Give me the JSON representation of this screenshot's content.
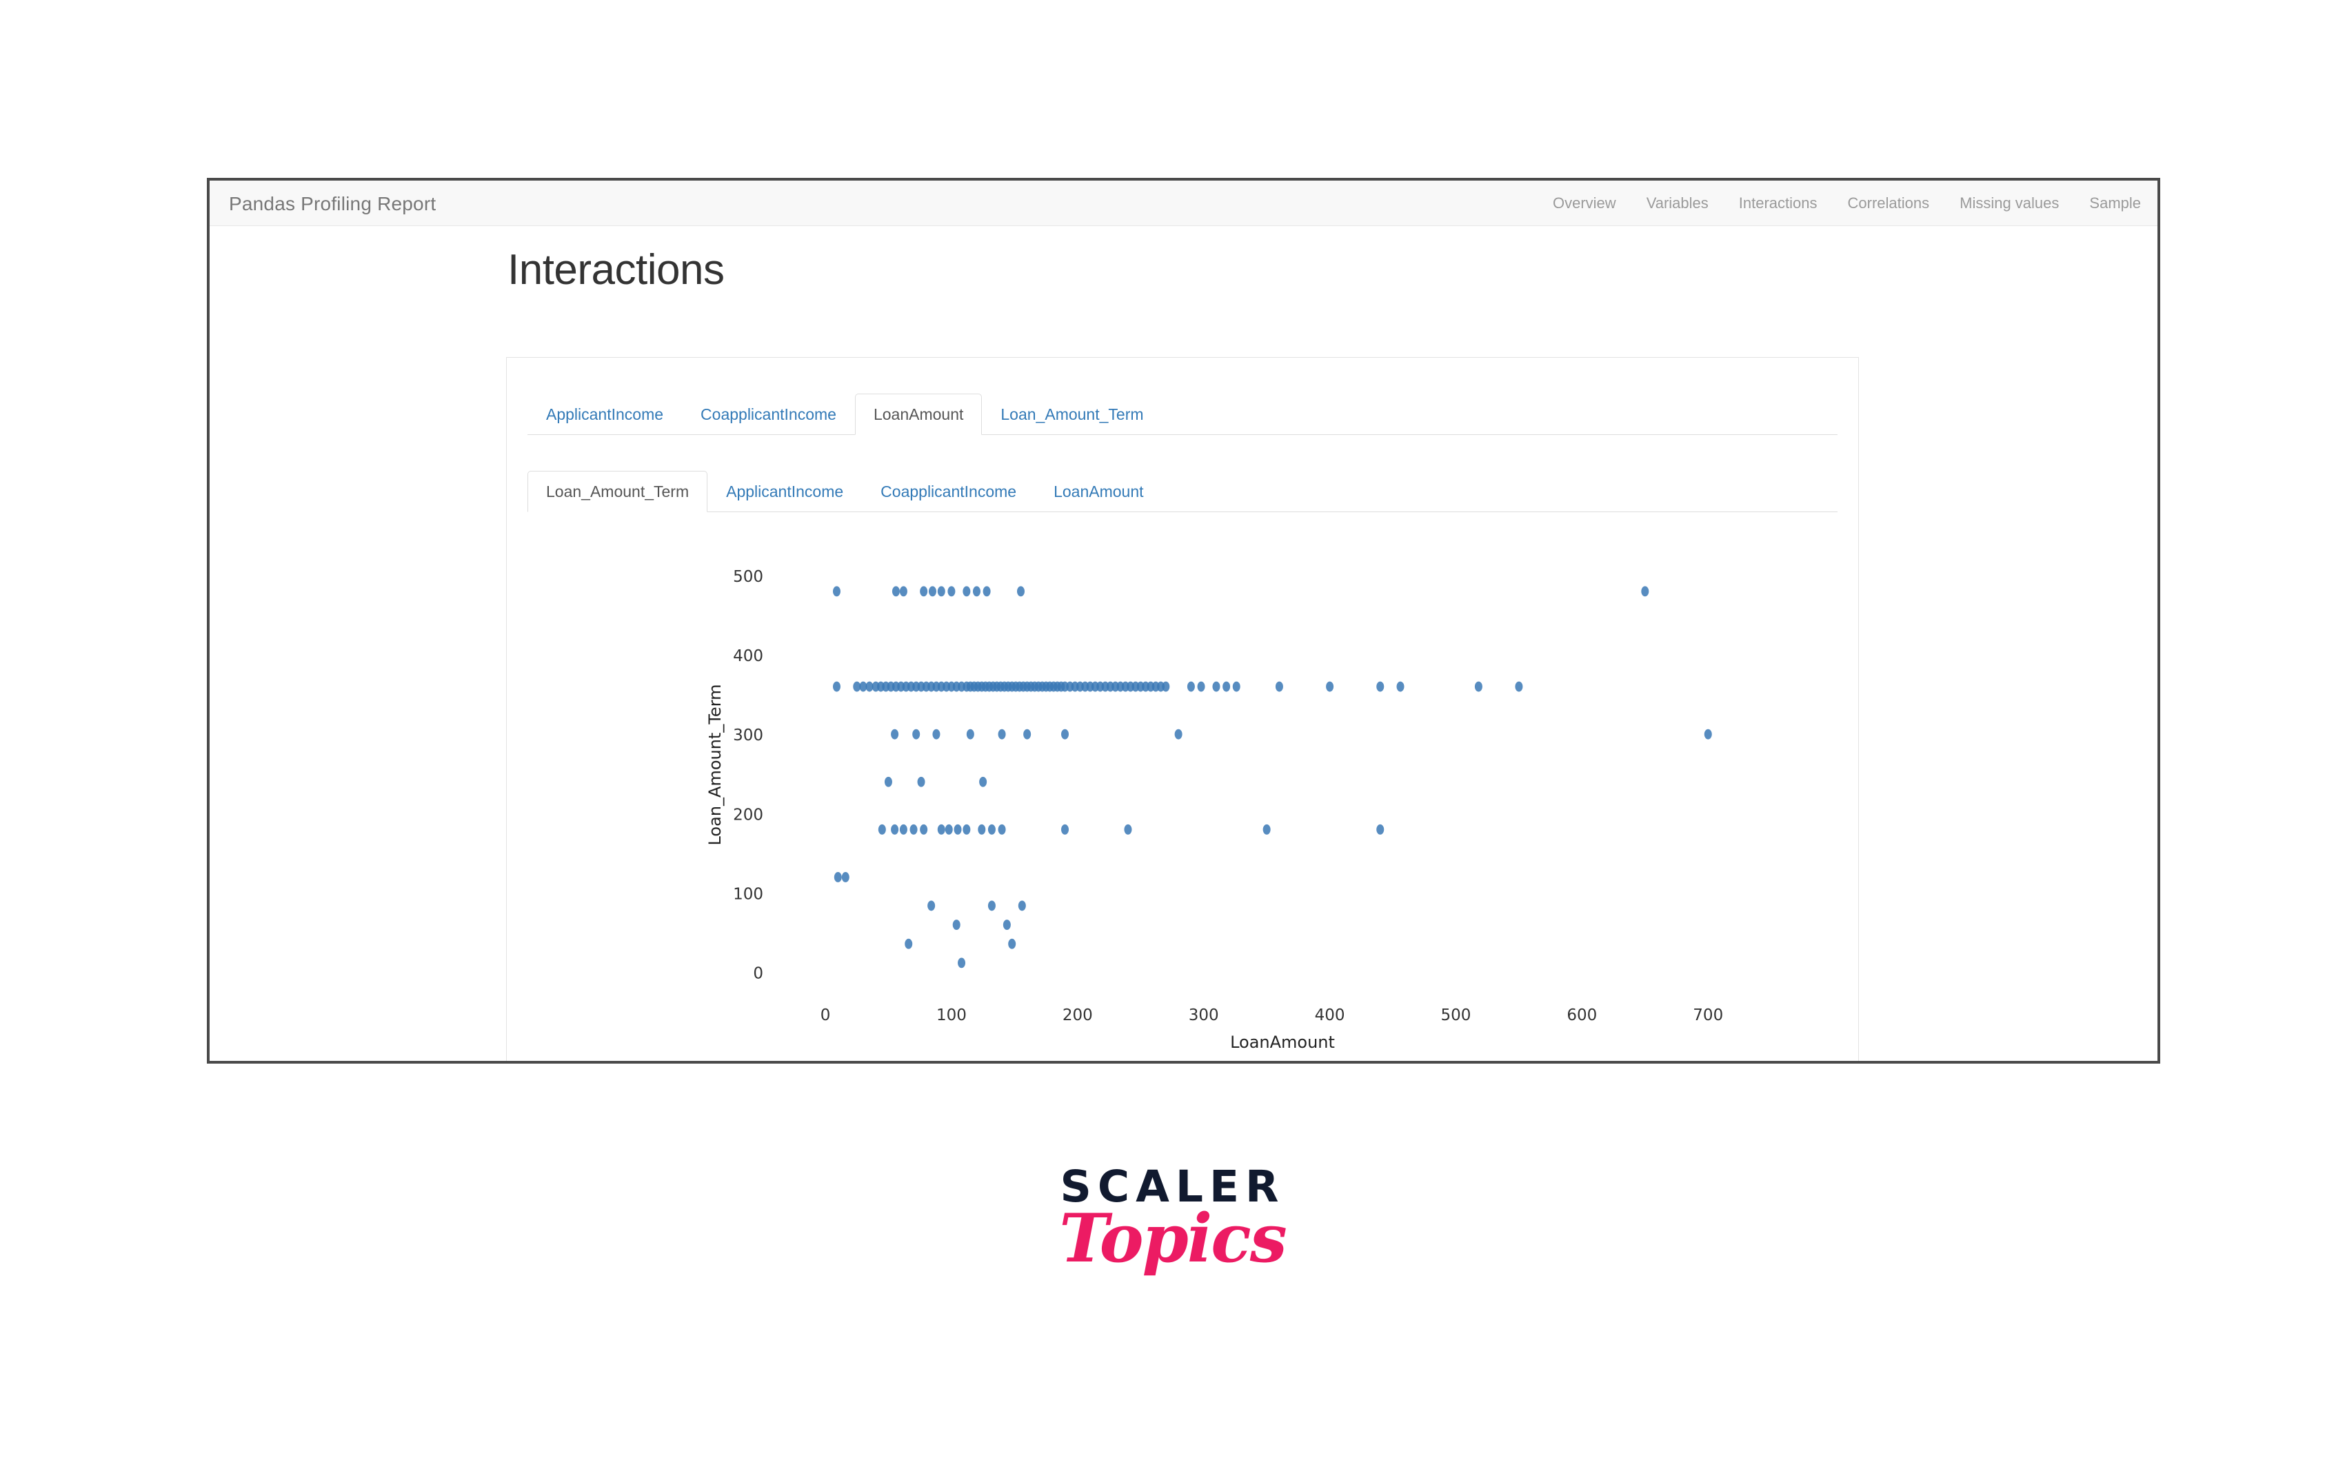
{
  "window": {
    "brand": "Pandas Profiling Report",
    "nav": [
      {
        "label": "Overview"
      },
      {
        "label": "Variables"
      },
      {
        "label": "Interactions"
      },
      {
        "label": "Correlations"
      },
      {
        "label": "Missing values"
      },
      {
        "label": "Sample"
      }
    ]
  },
  "page": {
    "title": "Interactions"
  },
  "tabs_outer": [
    {
      "label": "ApplicantIncome",
      "active": false
    },
    {
      "label": "CoapplicantIncome",
      "active": false
    },
    {
      "label": "LoanAmount",
      "active": true
    },
    {
      "label": "Loan_Amount_Term",
      "active": false
    }
  ],
  "tabs_inner": [
    {
      "label": "Loan_Amount_Term",
      "active": true
    },
    {
      "label": "ApplicantIncome",
      "active": false
    },
    {
      "label": "CoapplicantIncome",
      "active": false
    },
    {
      "label": "LoanAmount",
      "active": false
    }
  ],
  "logo": {
    "scaler": "SCALER",
    "topics": "Topics",
    "scaler_color": "#111a2f",
    "topics_color": "#ec1b63"
  },
  "chart_data": {
    "type": "scatter",
    "title": "",
    "xlabel": "LoanAmount",
    "ylabel": "Loan_Amount_Term",
    "xlim": [
      -35,
      760
    ],
    "ylim": [
      -22,
      545
    ],
    "xticks": [
      0,
      100,
      200,
      300,
      400,
      500,
      600,
      700
    ],
    "yticks": [
      0,
      100,
      200,
      300,
      400,
      500
    ],
    "grid": false,
    "legend": "none",
    "marker_color": "#3a78b5",
    "marker_size": 11,
    "marker_opacity": 0.85,
    "series": [
      {
        "name": "loans",
        "points": [
          [
            9,
            480
          ],
          [
            56,
            480
          ],
          [
            62,
            480
          ],
          [
            78,
            480
          ],
          [
            85,
            480
          ],
          [
            92,
            480
          ],
          [
            100,
            480
          ],
          [
            112,
            480
          ],
          [
            120,
            480
          ],
          [
            128,
            480
          ],
          [
            155,
            480
          ],
          [
            650,
            480
          ],
          [
            9,
            360
          ],
          [
            25,
            360
          ],
          [
            30,
            360
          ],
          [
            35,
            360
          ],
          [
            40,
            360
          ],
          [
            44,
            360
          ],
          [
            48,
            360
          ],
          [
            52,
            360
          ],
          [
            56,
            360
          ],
          [
            60,
            360
          ],
          [
            64,
            360
          ],
          [
            68,
            360
          ],
          [
            72,
            360
          ],
          [
            76,
            360
          ],
          [
            80,
            360
          ],
          [
            84,
            360
          ],
          [
            88,
            360
          ],
          [
            92,
            360
          ],
          [
            96,
            360
          ],
          [
            100,
            360
          ],
          [
            104,
            360
          ],
          [
            108,
            360
          ],
          [
            112,
            360
          ],
          [
            115,
            360
          ],
          [
            118,
            360
          ],
          [
            121,
            360
          ],
          [
            124,
            360
          ],
          [
            127,
            360
          ],
          [
            130,
            360
          ],
          [
            133,
            360
          ],
          [
            136,
            360
          ],
          [
            139,
            360
          ],
          [
            142,
            360
          ],
          [
            145,
            360
          ],
          [
            148,
            360
          ],
          [
            151,
            360
          ],
          [
            154,
            360
          ],
          [
            157,
            360
          ],
          [
            160,
            360
          ],
          [
            163,
            360
          ],
          [
            166,
            360
          ],
          [
            169,
            360
          ],
          [
            172,
            360
          ],
          [
            175,
            360
          ],
          [
            178,
            360
          ],
          [
            181,
            360
          ],
          [
            184,
            360
          ],
          [
            187,
            360
          ],
          [
            190,
            360
          ],
          [
            194,
            360
          ],
          [
            198,
            360
          ],
          [
            202,
            360
          ],
          [
            206,
            360
          ],
          [
            210,
            360
          ],
          [
            214,
            360
          ],
          [
            218,
            360
          ],
          [
            222,
            360
          ],
          [
            226,
            360
          ],
          [
            230,
            360
          ],
          [
            234,
            360
          ],
          [
            238,
            360
          ],
          [
            242,
            360
          ],
          [
            246,
            360
          ],
          [
            250,
            360
          ],
          [
            254,
            360
          ],
          [
            258,
            360
          ],
          [
            262,
            360
          ],
          [
            266,
            360
          ],
          [
            270,
            360
          ],
          [
            290,
            360
          ],
          [
            298,
            360
          ],
          [
            310,
            360
          ],
          [
            318,
            360
          ],
          [
            326,
            360
          ],
          [
            360,
            360
          ],
          [
            400,
            360
          ],
          [
            440,
            360
          ],
          [
            456,
            360
          ],
          [
            518,
            360
          ],
          [
            550,
            360
          ],
          [
            55,
            300
          ],
          [
            72,
            300
          ],
          [
            88,
            300
          ],
          [
            115,
            300
          ],
          [
            140,
            300
          ],
          [
            160,
            300
          ],
          [
            190,
            300
          ],
          [
            280,
            300
          ],
          [
            700,
            300
          ],
          [
            50,
            240
          ],
          [
            76,
            240
          ],
          [
            125,
            240
          ],
          [
            45,
            180
          ],
          [
            55,
            180
          ],
          [
            62,
            180
          ],
          [
            70,
            180
          ],
          [
            78,
            180
          ],
          [
            92,
            180
          ],
          [
            98,
            180
          ],
          [
            105,
            180
          ],
          [
            112,
            180
          ],
          [
            124,
            180
          ],
          [
            132,
            180
          ],
          [
            140,
            180
          ],
          [
            190,
            180
          ],
          [
            240,
            180
          ],
          [
            350,
            180
          ],
          [
            440,
            180
          ],
          [
            10,
            120
          ],
          [
            16,
            120
          ],
          [
            84,
            84
          ],
          [
            132,
            84
          ],
          [
            156,
            84
          ],
          [
            104,
            60
          ],
          [
            144,
            60
          ],
          [
            66,
            36
          ],
          [
            148,
            36
          ],
          [
            108,
            12
          ]
        ]
      }
    ]
  }
}
